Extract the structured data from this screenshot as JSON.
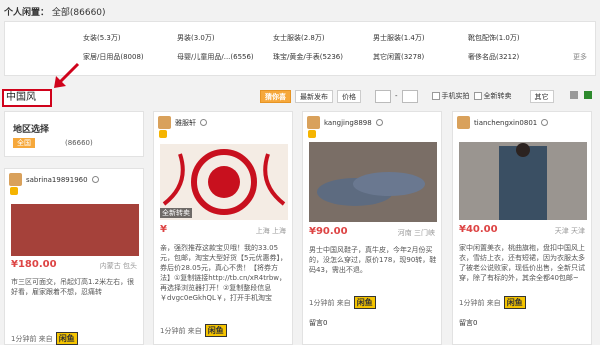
{
  "header": {
    "title": "个人闲置：",
    "all_label": "全部(86660)"
  },
  "categories": [
    [
      "女装(5.3万)",
      "男装(3.0万)",
      "女士服装(2.8万)",
      "男士服装(1.4万)",
      "靴包配饰(1.0万)"
    ],
    [
      "家居/日用品(8008)",
      "母婴/儿童用品/...(6556)",
      "珠宝/黄金/手表(5236)",
      "其它闲置(3278)",
      "奢侈名品(3212)"
    ]
  ],
  "more_label": "更多",
  "keyword": "中国风",
  "toolbar": {
    "recommend": "猜你喜",
    "newest": "最新发布",
    "price": "价格",
    "price_sep": "-",
    "phone": "手机实拍",
    "new_item": "全新转卖",
    "other": "其它"
  },
  "area": {
    "title": "地区选择",
    "badge": "全国",
    "count": "(86660)"
  },
  "cards": [
    {
      "user": "sabrina19891960",
      "price": "¥180.00",
      "loc": "内蒙古 包头",
      "desc": "市三区可面交，吊起灯高1.2米左右，很好看，雇家跟着不想，忍痛转",
      "time": "1分钟前 来自",
      "tmall": "闲鱼"
    },
    {
      "user": "雅服轩",
      "tag": "全新转卖",
      "price": "¥",
      "loc": "上海 上海",
      "desc": "亲，强烈推荐这款宝贝哦！我的33.05元，包邮，淘宝大型好货【5元优惠券】，券后价28.05元，真心不贵！【将券方法】①复制链接http://tb.cn/xR4trbw，再选择浏览器打开！②复制整段信息￥dvgc0eGkhQL￥，打开手机淘宝",
      "time": "1分钟前 来自",
      "tmall": "闲鱼"
    },
    {
      "user": "kangjing8898",
      "price": "¥90.00",
      "loc": "河南 三门峡",
      "desc": "男士中国风鞋子，真牛皮，今年2月份买的，没怎么穿过，原价178，现90转，鞋码43，需出不退。",
      "time": "1分钟前 来自",
      "tmall": "闲鱼",
      "reply": "留言0"
    },
    {
      "user": "tianchengxin0801",
      "price": "¥40.00",
      "loc": "天津 天津",
      "desc": "家中闲置美衣，桃曲旗袍，盘扣中国风上衣，雪纺上衣，还有短裙，因为衣服太多了被老公说败家，现低价出售，全新只试穿，除了有标的外，其余全都40包邮~",
      "time": "1分钟前 来自",
      "tmall": "闲鱼",
      "reply": "留言0"
    }
  ]
}
